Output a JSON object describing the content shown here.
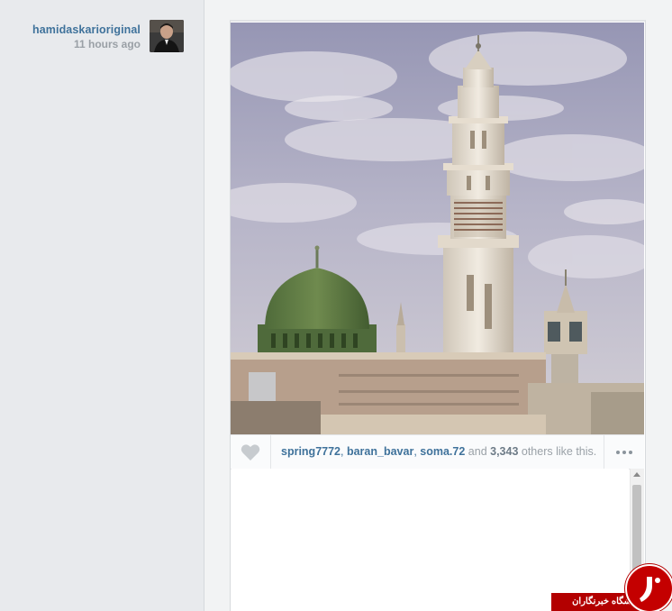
{
  "post": {
    "author": "hamidaskarioriginal",
    "time": "11 hours ago"
  },
  "likes": {
    "users": [
      "spring7772",
      "baran_bavar",
      "soma.72"
    ],
    "separator": ", ",
    "and_text": " and ",
    "count": "3,343",
    "suffix": " others like this."
  },
  "icons": {
    "like": "heart-icon",
    "more": "more-options-icon",
    "scroll_up": "scroll-up-arrow"
  },
  "watermark": {
    "text": "باشگاه خبرنگاران"
  },
  "colors": {
    "link": "#3f729b",
    "muted": "#9aa1a7",
    "watermark_red": "#b30000"
  }
}
